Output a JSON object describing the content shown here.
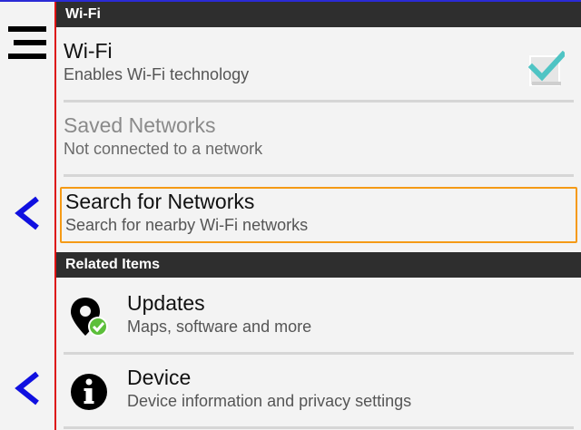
{
  "sections": {
    "wifi_header": "Wi-Fi",
    "related_header": "Related Items"
  },
  "wifi": {
    "title": "Wi-Fi",
    "subtitle": "Enables Wi-Fi technology",
    "checked": true
  },
  "saved_networks": {
    "title": "Saved Networks",
    "subtitle": "Not connected to a network"
  },
  "search_networks": {
    "title": "Search for Networks",
    "subtitle": "Search for nearby Wi-Fi networks"
  },
  "updates": {
    "title": "Updates",
    "subtitle": "Maps, software and more"
  },
  "device": {
    "title": "Device",
    "subtitle": "Device information and privacy settings"
  },
  "icons": {
    "menu": "hamburger-menu-icon",
    "back": "chevron-left-icon",
    "checkbox": "checkbox-checked-icon",
    "updates": "map-pin-check-icon",
    "device": "info-circle-icon"
  },
  "colors": {
    "header_bg": "#2e2e2e",
    "focus_border": "#f59a16",
    "back_arrow": "#1010e0",
    "check": "#4fc4c4",
    "badge_green": "#5cbf3a"
  }
}
